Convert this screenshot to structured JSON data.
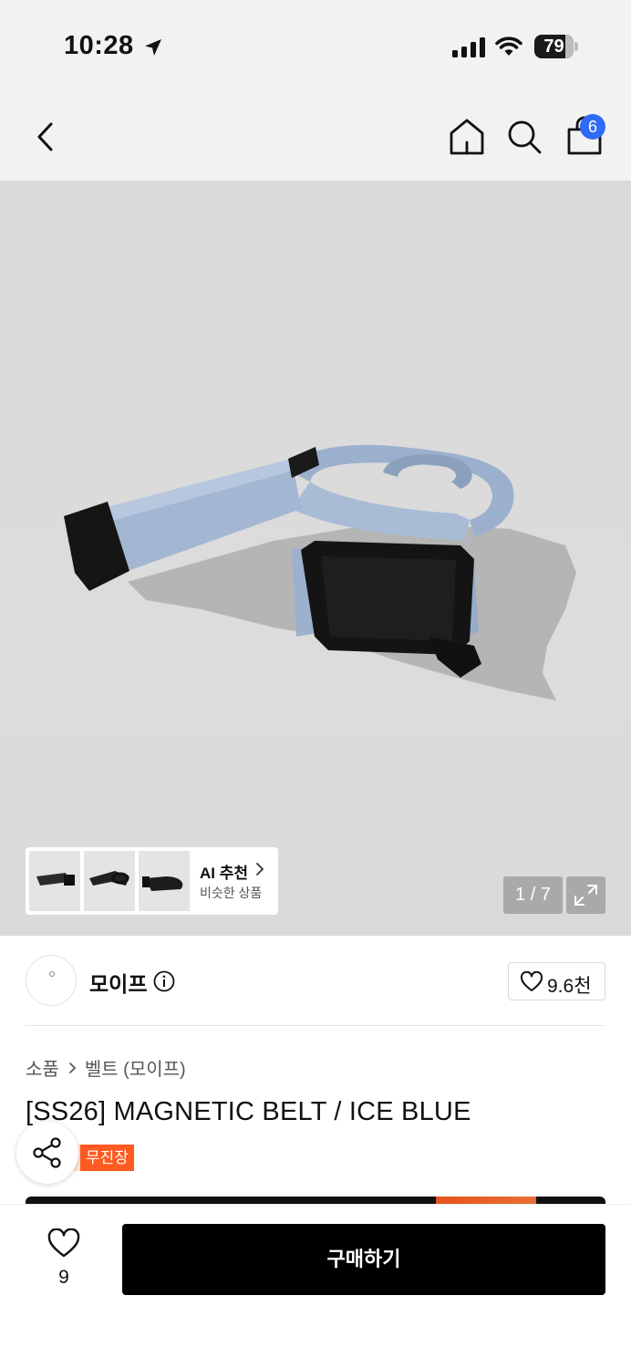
{
  "status_bar": {
    "time": "10:28",
    "battery_level": "79",
    "icons": [
      "location-arrow-icon",
      "signal-bars-icon",
      "wifi-icon",
      "battery-icon"
    ]
  },
  "nav": {
    "icons": [
      "back-chevron-icon",
      "home-icon",
      "search-icon",
      "shopping-bag-icon"
    ],
    "cart_badge": "6"
  },
  "gallery": {
    "page_counter": "1 / 7",
    "ai_recommend": {
      "title": "AI 추천",
      "subtitle": "비슷한 상품"
    }
  },
  "brand": {
    "name": "모이프",
    "like_count": "9.6천"
  },
  "breadcrumb": [
    "소품",
    "벨트 (모이프)"
  ],
  "product": {
    "title": "[SS26] MAGNETIC BELT / ICE BLUE",
    "tag": "무진장"
  },
  "bottom_bar": {
    "wish_count": "9",
    "buy_label": "구매하기"
  },
  "colors": {
    "accent_badge": "#2f6bf6",
    "tag_orange": "#ff5a1f",
    "buy_button": "#000000",
    "belt_blue": "#9fb3cf"
  }
}
